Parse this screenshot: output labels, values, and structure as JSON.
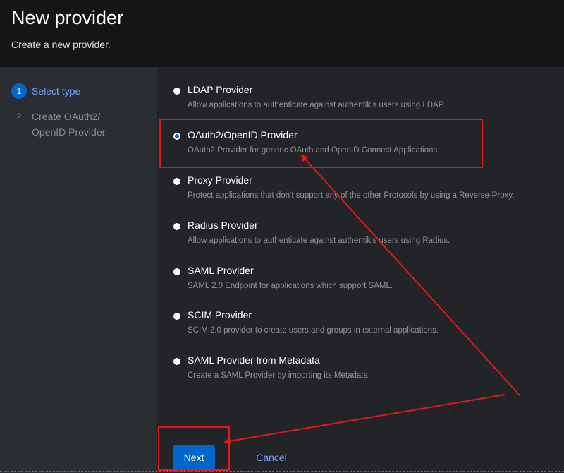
{
  "header": {
    "title": "New provider",
    "subtitle": "Create a new provider."
  },
  "steps": [
    {
      "number": "1",
      "label": "Select type"
    },
    {
      "number": "2",
      "label": "Create OAuth2/ OpenID Provider"
    }
  ],
  "providers": [
    {
      "title": "LDAP Provider",
      "description": "Allow applications to authenticate against authentik's users using LDAP."
    },
    {
      "title": "OAuth2/OpenID Provider",
      "description": "OAuth2 Provider for generic OAuth and OpenID Connect Applications."
    },
    {
      "title": "Proxy Provider",
      "description": "Protect applications that don't support any of the other Protocols by using a Reverse-Proxy."
    },
    {
      "title": "Radius Provider",
      "description": "Allow applications to authenticate against authentik's users using Radius."
    },
    {
      "title": "SAML Provider",
      "description": "SAML 2.0 Endpoint for applications which support SAML."
    },
    {
      "title": "SCIM Provider",
      "description": "SCIM 2.0 provider to create users and groups in external applications."
    },
    {
      "title": "SAML Provider from Metadata",
      "description": "Create a SAML Provider by importing its Metadata."
    }
  ],
  "selected_provider": "OAuth2/OpenID Provider",
  "footer": {
    "next_label": "Next",
    "cancel_label": "Cancel"
  },
  "colors": {
    "accent": "#0066cc",
    "link": "#73a5ff",
    "annotation": "#e31919"
  }
}
